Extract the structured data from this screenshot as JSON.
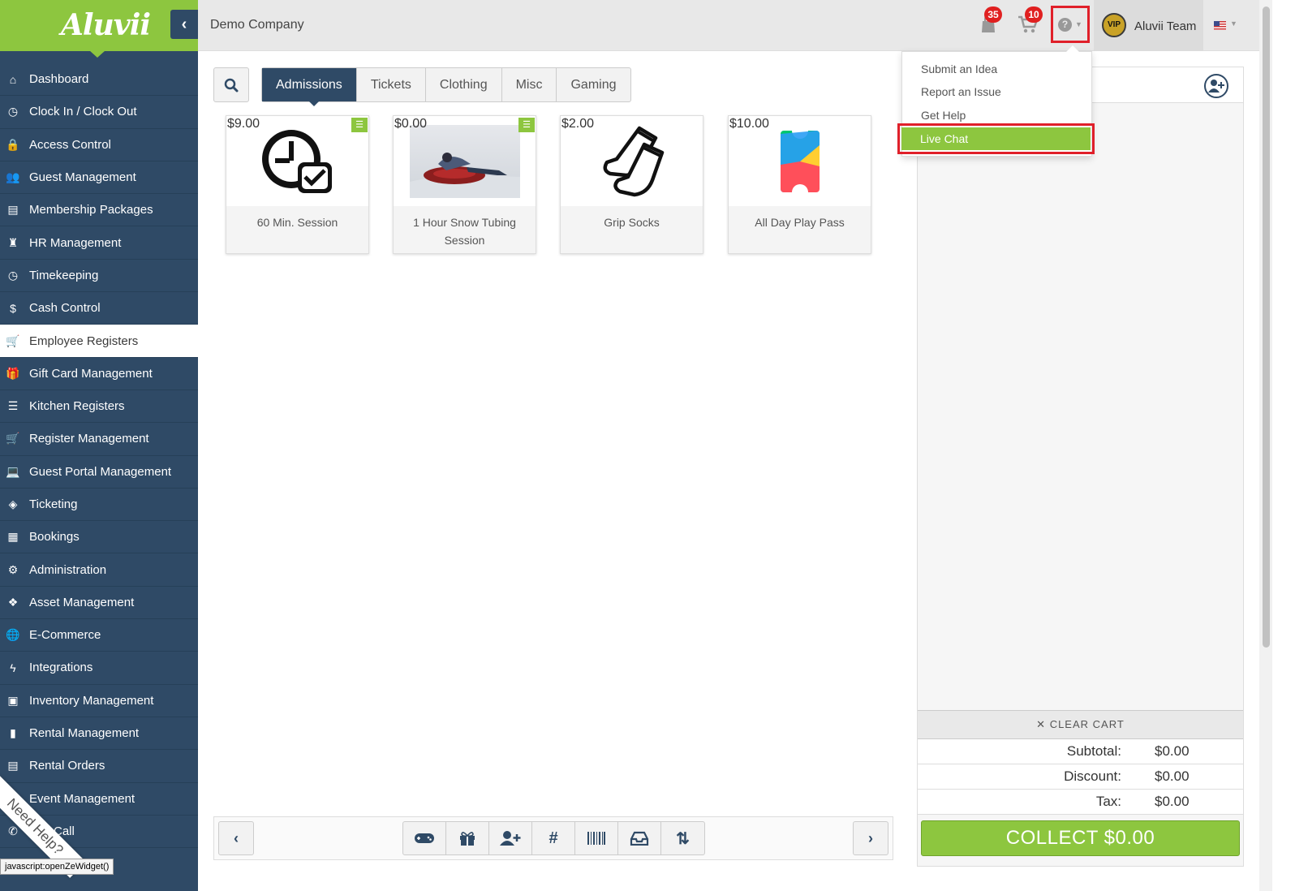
{
  "brand": {
    "logo": "Aluvii",
    "accent": "#8dc63f",
    "primary": "#2f4a66"
  },
  "sidebar": {
    "collapse_icon": "chevron-left-icon",
    "items": [
      {
        "label": "Dashboard",
        "icon": "home-icon",
        "glyph": "⌂"
      },
      {
        "label": "Clock In / Clock Out",
        "icon": "clock-icon",
        "glyph": "◷"
      },
      {
        "label": "Access Control",
        "icon": "lock-icon",
        "glyph": "🔒"
      },
      {
        "label": "Guest Management",
        "icon": "users-icon",
        "glyph": "👥"
      },
      {
        "label": "Membership Packages",
        "icon": "card-icon",
        "glyph": "▤"
      },
      {
        "label": "HR Management",
        "icon": "user-tie-icon",
        "glyph": "♜"
      },
      {
        "label": "Timekeeping",
        "icon": "clock-icon",
        "glyph": "◷"
      },
      {
        "label": "Cash Control",
        "icon": "dollar-icon",
        "glyph": "$"
      },
      {
        "label": "Employee Registers",
        "icon": "cart-icon",
        "glyph": "🛒"
      },
      {
        "label": "Gift Card Management",
        "icon": "gift-icon",
        "glyph": "🎁"
      },
      {
        "label": "Kitchen Registers",
        "icon": "list-icon",
        "glyph": "☰"
      },
      {
        "label": "Register Management",
        "icon": "cart-plus-icon",
        "glyph": "🛒"
      },
      {
        "label": "Guest Portal Management",
        "icon": "laptop-icon",
        "glyph": "💻"
      },
      {
        "label": "Ticketing",
        "icon": "ticket-icon",
        "glyph": "◈"
      },
      {
        "label": "Bookings",
        "icon": "calendar-icon",
        "glyph": "▦"
      },
      {
        "label": "Administration",
        "icon": "cogs-icon",
        "glyph": "⚙"
      },
      {
        "label": "Asset Management",
        "icon": "cubes-icon",
        "glyph": "❖"
      },
      {
        "label": "E-Commerce",
        "icon": "globe-icon",
        "glyph": "🌐"
      },
      {
        "label": "Integrations",
        "icon": "bolt-icon",
        "glyph": "ϟ"
      },
      {
        "label": "Inventory Management",
        "icon": "archive-icon",
        "glyph": "▣"
      },
      {
        "label": "Rental Management",
        "icon": "clipboard-icon",
        "glyph": "▮"
      },
      {
        "label": "Rental Orders",
        "icon": "book-icon",
        "glyph": "▤"
      },
      {
        "label": "Event Management",
        "icon": "calendar-icon",
        "glyph": "▦"
      },
      {
        "label": "Roll Call",
        "icon": "phone-icon",
        "glyph": "✆"
      }
    ],
    "need_help": "Need Help?",
    "status_tip": "javascript:openZeWidget()"
  },
  "topbar": {
    "company": "Demo Company",
    "bag_badge": "35",
    "cart_badge": "10",
    "help_icon": "question-circle-icon",
    "user_name": "Aluvii Team",
    "vip_badge": "VIP",
    "flag_icon": "us-flag-icon"
  },
  "help_menu": {
    "items": [
      "Submit an Idea",
      "Report an Issue",
      "Get Help"
    ],
    "live_chat": "Live Chat"
  },
  "tabs": [
    "Admissions",
    "Tickets",
    "Clothing",
    "Misc",
    "Gaming"
  ],
  "products": [
    {
      "price": "$9.00",
      "name": "60 Min. Session",
      "image": "clock-check-icon",
      "has_modifiers": true
    },
    {
      "price": "$0.00",
      "name": "1 Hour Snow Tubing Session",
      "image": "snow-tubing-photo",
      "has_modifiers": true
    },
    {
      "price": "$2.00",
      "name": "Grip Socks",
      "image": "socks-icon",
      "has_modifiers": false
    },
    {
      "price": "$10.00",
      "name": "All Day Play Pass",
      "image": "play-pass-icon",
      "has_modifiers": false
    }
  ],
  "cart": {
    "clear_label": "CLEAR CART",
    "subtotal_label": "Subtotal:",
    "subtotal": "$0.00",
    "discount_label": "Discount:",
    "discount": "$0.00",
    "tax_label": "Tax:",
    "tax": "$0.00",
    "collect_label": "COLLECT $0.00"
  },
  "toolbar": {
    "tools": [
      "gamepad-icon",
      "gift-icon",
      "user-plus-icon",
      "hash-icon",
      "barcode-icon",
      "inbox-icon",
      "sort-icon"
    ]
  }
}
